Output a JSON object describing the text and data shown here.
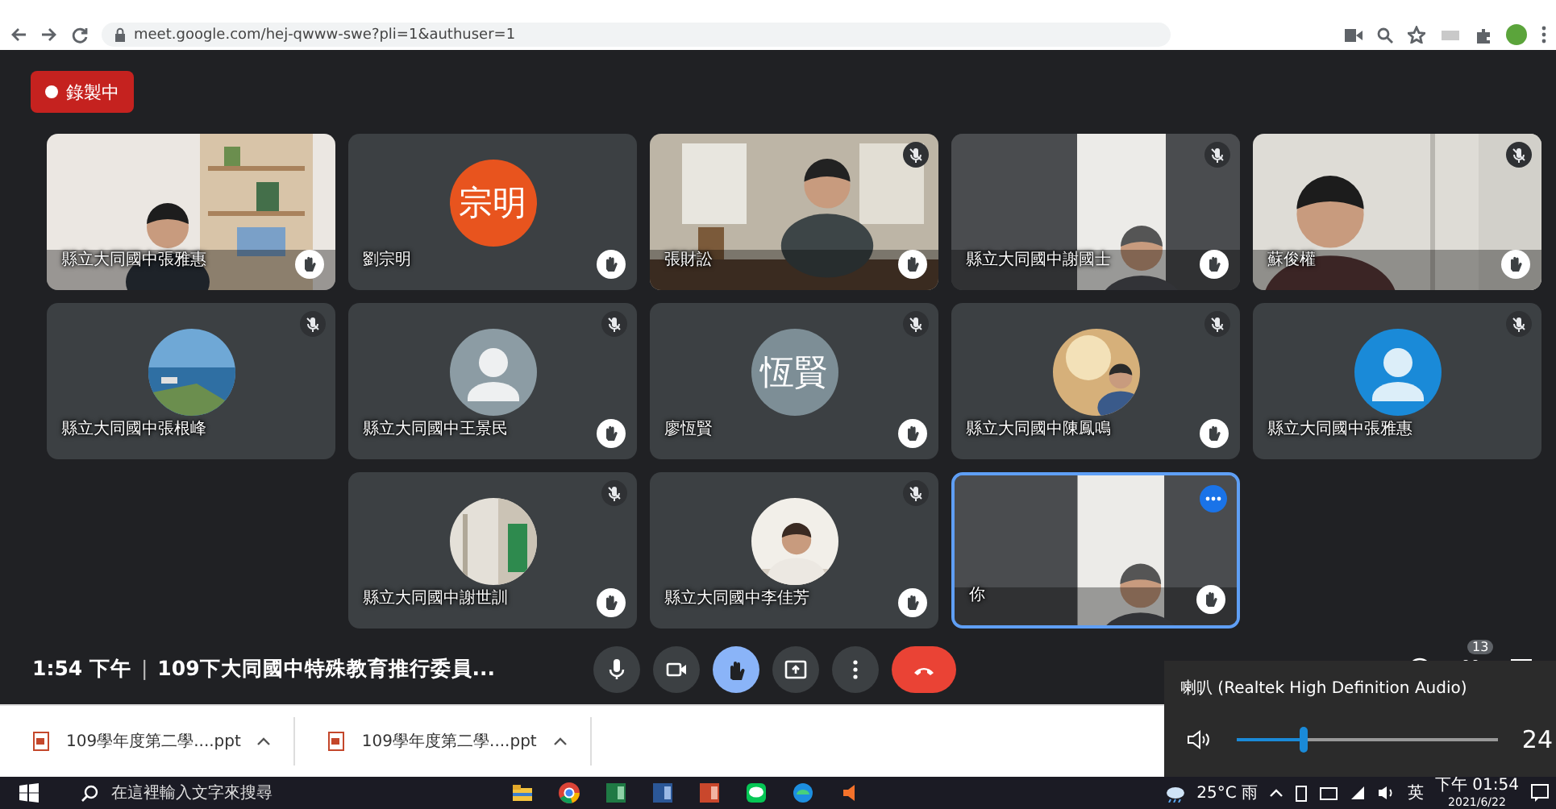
{
  "browser": {
    "url": "meet.google.com/hej-qwww-swe?pli=1&authuser=1"
  },
  "recording": {
    "label": "錄製中"
  },
  "tiles": [
    [
      {
        "name": "縣立大同國中張雅惠",
        "kind": "video",
        "muted": false,
        "hand_raised": true,
        "highlighted": false
      },
      {
        "name": "劉宗明",
        "kind": "initials",
        "initials": "宗明",
        "color": "#e8541e",
        "muted": false,
        "hand_raised": true,
        "highlighted": false
      },
      {
        "name": "張財訟",
        "kind": "video",
        "muted": true,
        "hand_raised": true,
        "highlighted": false
      },
      {
        "name": "縣立大同國中謝國士",
        "kind": "video",
        "muted": true,
        "hand_raised": true,
        "highlighted": false
      },
      {
        "name": "蘇俊權",
        "kind": "video",
        "muted": true,
        "hand_raised": true,
        "highlighted": false
      }
    ],
    [
      {
        "name": "縣立大同國中張根峰",
        "muted": true,
        "hand_raised": false,
        "highlighted": false
      },
      {
        "name": "縣立大同國中王景民",
        "kind": "silhouette",
        "color": "#8c9ca4",
        "muted": true,
        "hand_raised": true,
        "highlighted": false
      },
      {
        "name": "廖恆賢",
        "kind": "initials",
        "initials": "恆賢",
        "color": "#7d8e96",
        "muted": true,
        "hand_raised": true,
        "highlighted": false
      },
      {
        "name": "縣立大同國中陳鳳鳴",
        "muted": true,
        "hand_raised": true,
        "highlighted": false
      },
      {
        "name": "縣立大同國中張雅惠",
        "kind": "silhouette",
        "color": "#1a8ad8",
        "muted": true,
        "hand_raised": false,
        "highlighted": false
      }
    ],
    [
      {
        "name": "縣立大同國中謝世訓",
        "muted": true,
        "hand_raised": true,
        "highlighted": false
      },
      {
        "name": "縣立大同國中李佳芳",
        "muted": true,
        "hand_raised": true,
        "highlighted": false
      },
      {
        "name": "你",
        "kind": "video",
        "muted": false,
        "hand_raised": true,
        "highlighted": true
      }
    ]
  ],
  "bottom_bar": {
    "time": "1:54 下午",
    "separator": "|",
    "meeting_title": "109下大同國中特殊教育推行委員...",
    "controls": [
      {
        "kind": "mic",
        "selected": false
      },
      {
        "kind": "camera",
        "selected": false
      },
      {
        "kind": "hand",
        "selected": true
      },
      {
        "kind": "present",
        "selected": false
      },
      {
        "kind": "more",
        "selected": false
      },
      {
        "kind": "end",
        "selected": false
      }
    ],
    "participant_count": "13"
  },
  "downloads": [
    {
      "name": "109學年度第二學....ppt"
    },
    {
      "name": "109學年度第二學....ppt"
    }
  ],
  "taskbar": {
    "search_placeholder": "在這裡輸入文字來搜尋",
    "weather": "25°C 雨",
    "ime": "英",
    "time": "下午 01:54",
    "date": "2021/6/22"
  },
  "volume": {
    "device": "喇叭 (Realtek High Definition Audio)",
    "level": 0.25,
    "reading": "24"
  }
}
